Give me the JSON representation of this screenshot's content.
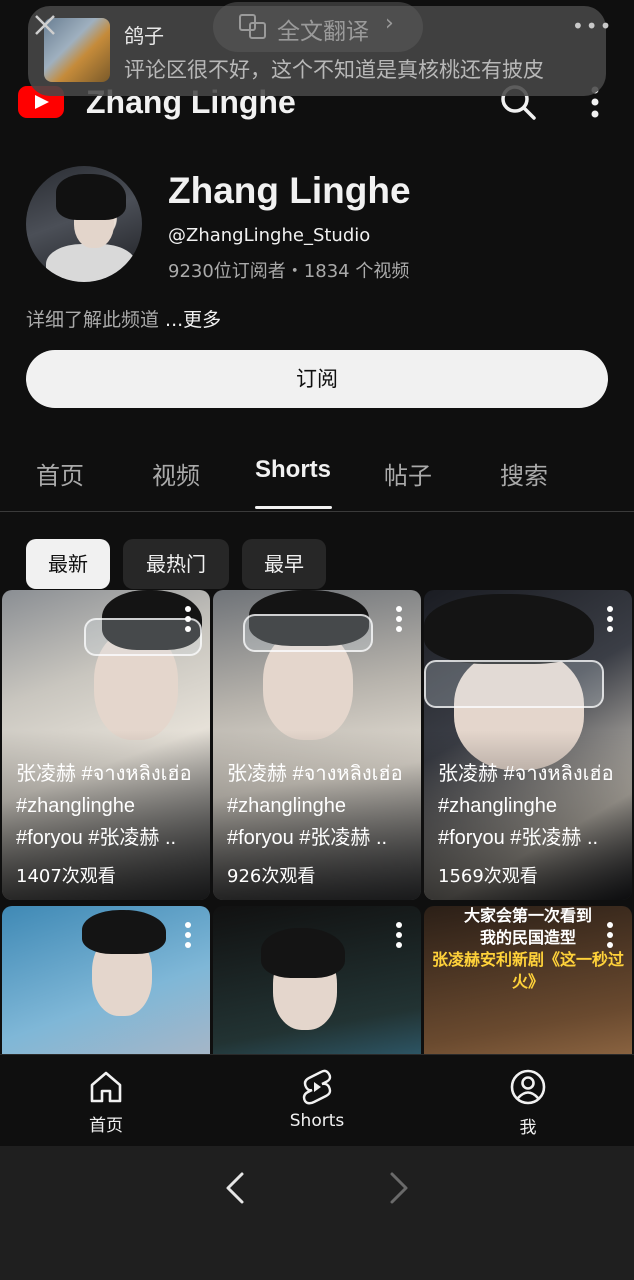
{
  "notification": {
    "sender": "鸽子",
    "message": "评论区很不好，这个不知道是真核桃还有披皮",
    "translate_label": "全文翻译",
    "more": "•••"
  },
  "app_bar": {
    "title": "Zhang Linghe",
    "icons": [
      "youtube-logo",
      "search-icon",
      "more-vert-icon"
    ]
  },
  "channel": {
    "name": "Zhang Linghe",
    "handle": "@ZhangLinghe_Studio",
    "stats": "9230位订阅者・1834 个视频",
    "description": "详细了解此频道 ",
    "description_more": "...更多",
    "subscribe_label": "订阅"
  },
  "tabs": [
    {
      "label": "首页",
      "active": false
    },
    {
      "label": "视频",
      "active": false
    },
    {
      "label": "Shorts",
      "active": true
    },
    {
      "label": "帖子",
      "active": false
    },
    {
      "label": "搜索",
      "active": false
    }
  ],
  "chips": [
    {
      "label": "最新",
      "active": true
    },
    {
      "label": "最热门",
      "active": false
    },
    {
      "label": "最早",
      "active": false
    }
  ],
  "shorts": [
    {
      "caption": "张凌赫 #จางหลิงเฮ่อ #zhanglinghe #foryou #张凌赫 ..",
      "views": "1407次观看"
    },
    {
      "caption": "张凌赫 #จางหลิงเฮ่อ #zhanglinghe #foryou #张凌赫 ..",
      "views": "926次观看"
    },
    {
      "caption": "张凌赫 #จางหลิงเฮ่อ #zhanglinghe #foryou #张凌赫 ..",
      "views": "1569次观看"
    },
    {
      "caption": "",
      "views": ""
    },
    {
      "caption": "",
      "views": ""
    },
    {
      "caption": "",
      "views": "",
      "banner": [
        "大家会第一次看到",
        "我的民国造型",
        "张凌赫安利新剧《这一秒过火》"
      ]
    }
  ],
  "bottom_nav": [
    {
      "label": "首页",
      "icon": "home-icon"
    },
    {
      "label": "Shorts",
      "icon": "shorts-icon"
    },
    {
      "label": "我",
      "icon": "account-icon"
    }
  ],
  "colors": {
    "background": "#0f0f0f",
    "brand_red": "#ff0000",
    "chip_bg": "#272727",
    "text_primary": "#f1f1f1",
    "text_secondary": "#aaaaaa"
  }
}
